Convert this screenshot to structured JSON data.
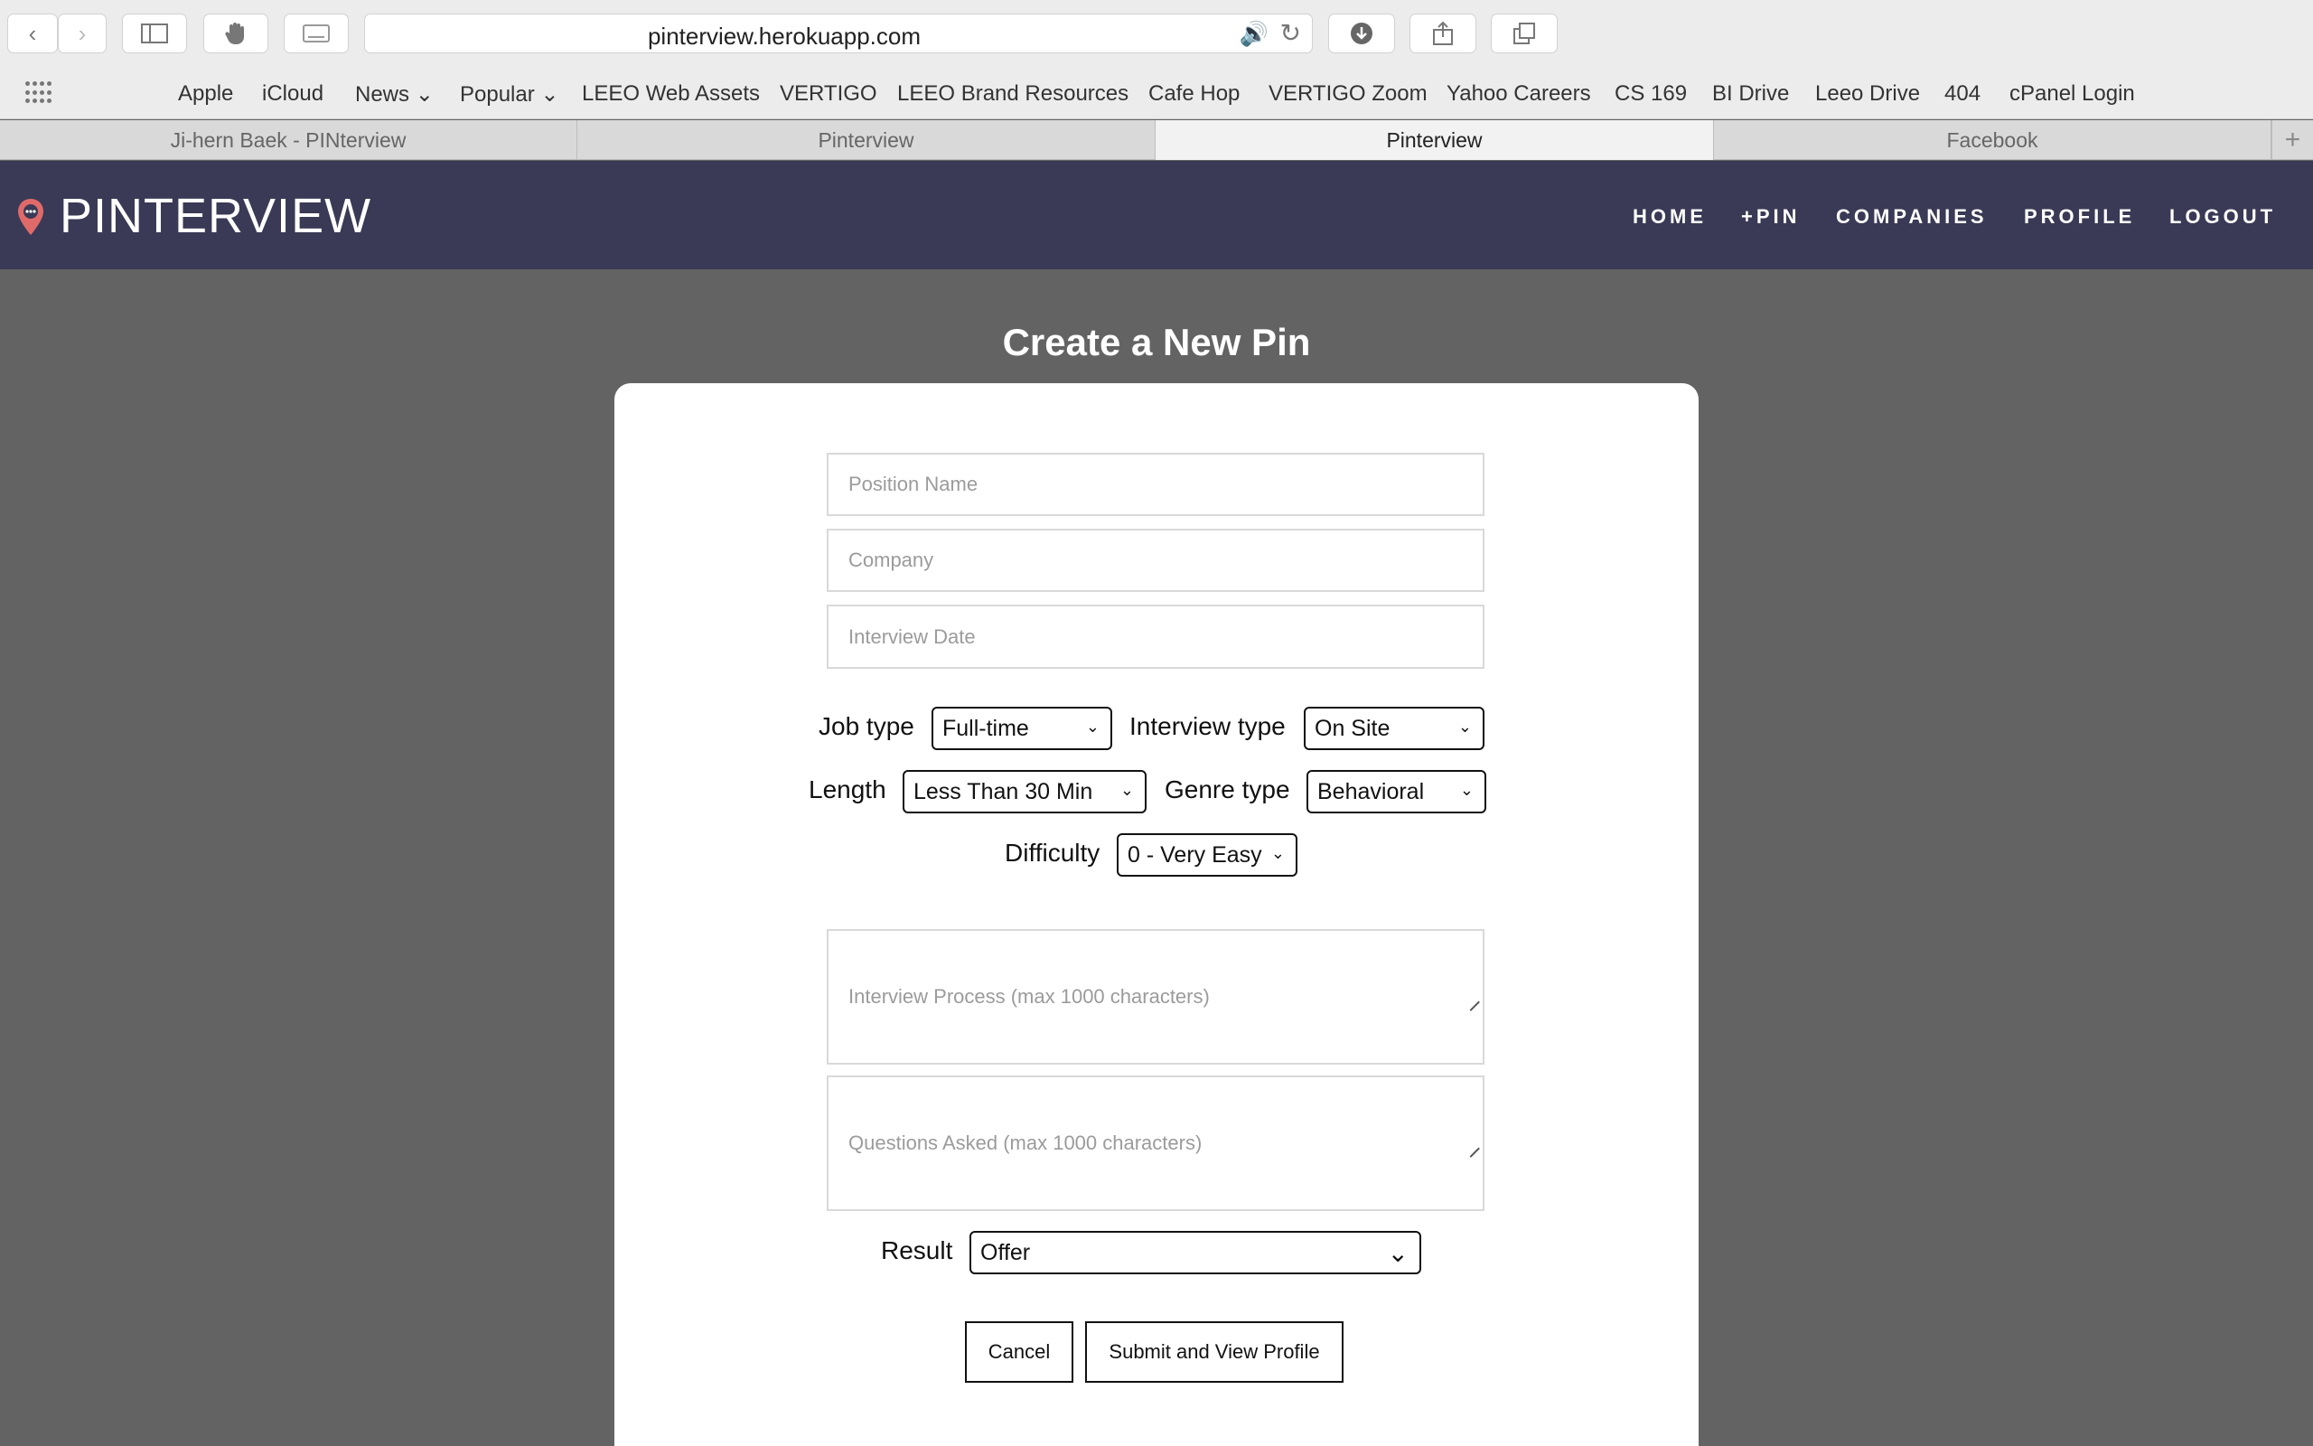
{
  "browser": {
    "url": "pinterview.herokuapp.com",
    "bookmarks": [
      "Apple",
      "iCloud",
      "News",
      "Popular",
      "LEEO Web Assets",
      "VERTIGO",
      "LEEO Brand Resources",
      "Cafe Hop",
      "VERTIGO Zoom",
      "Yahoo Careers",
      "CS 169",
      "BI Drive",
      "Leeo Drive",
      "404",
      "cPanel Login"
    ],
    "tabs": [
      {
        "label": "Ji-hern Baek - PINterview",
        "active": false
      },
      {
        "label": "Pinterview",
        "active": false
      },
      {
        "label": "Pinterview",
        "active": true
      },
      {
        "label": "Facebook",
        "active": false
      }
    ]
  },
  "site": {
    "logo": "PINTERVIEW",
    "nav": [
      "HOME",
      "+PIN",
      "COMPANIES",
      "PROFILE",
      "LOGOUT"
    ],
    "colors": {
      "nav_bg": "#3a3a56",
      "pin_icon": "#e06a6a",
      "page_bg": "#636363"
    }
  },
  "form": {
    "title": "Create a New Pin",
    "position_placeholder": "Position Name",
    "company_placeholder": "Company",
    "date_placeholder": "Interview Date",
    "job_type_label": "Job type",
    "job_type_value": "Full-time",
    "interview_type_label": "Interview type",
    "interview_type_value": "On Site",
    "length_label": "Length",
    "length_value": "Less Than 30 Min",
    "genre_type_label": "Genre type",
    "genre_type_value": "Behavioral",
    "difficulty_label": "Difficulty",
    "difficulty_value": "0 - Very Easy",
    "process_placeholder": "Interview Process (max 1000 characters)",
    "questions_placeholder": "Questions Asked (max 1000 characters)",
    "result_label": "Result",
    "result_value": "Offer",
    "cancel_label": "Cancel",
    "submit_label": "Submit and View Profile"
  }
}
